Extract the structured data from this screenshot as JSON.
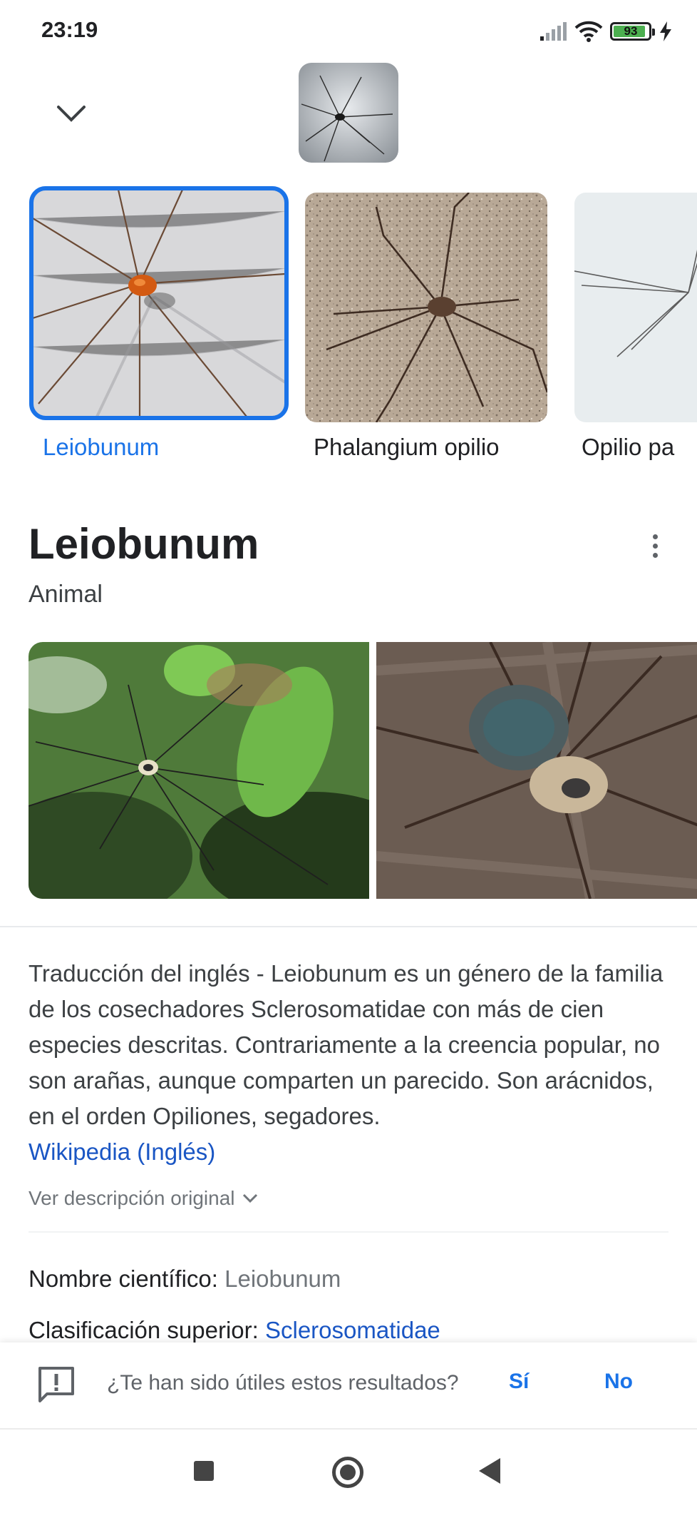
{
  "status": {
    "time": "23:19",
    "battery": "93"
  },
  "query_image": {
    "name": "query-thumbnail"
  },
  "carousel": [
    {
      "label": "Leiobunum",
      "selected": true
    },
    {
      "label": "Phalangium opilio",
      "selected": false
    },
    {
      "label": "Opilio pa",
      "selected": false
    }
  ],
  "entity": {
    "title": "Leiobunum",
    "subtitle": "Animal",
    "description": "Traducción del inglés - Leiobunum es un género de la familia de los cosechadores Sclerosomatidae con más de cien especies descritas. Contrariamente a la creencia popular, no son arañas, aunque comparten un parecido. Son arácnidos, en el orden Opiliones, segadores.",
    "source_link": "Wikipedia (Inglés)",
    "see_original": "Ver descripción original"
  },
  "facts": [
    {
      "label": "Nombre científico:",
      "value": "Leiobunum"
    },
    {
      "label": "Clasificación superior:",
      "value": "Sclerosomatidae"
    }
  ],
  "feedback": {
    "question": "¿Te han sido útiles estos resultados?",
    "yes": "Sí",
    "no": "No"
  },
  "colors": {
    "accent": "#1a73e8",
    "link": "#1a56c4"
  }
}
